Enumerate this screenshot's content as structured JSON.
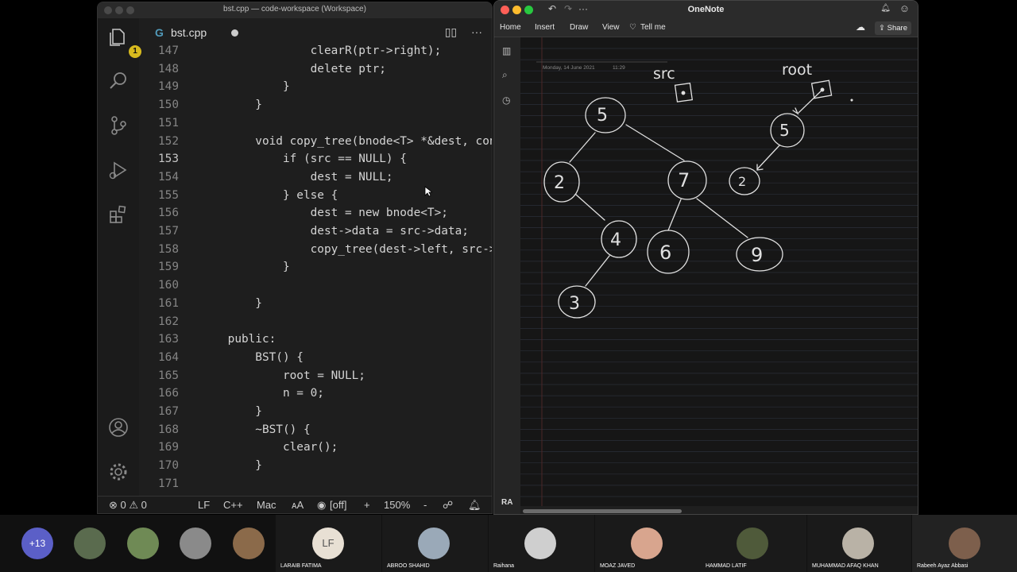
{
  "vscode": {
    "window_title": "bst.cpp — code-workspace (Workspace)",
    "explorer_badge": "1",
    "tab_label": "bst.cpp",
    "tab_icon": "G",
    "code_lines": [
      {
        "num": "147",
        "code": "                clearR(ptr->right);"
      },
      {
        "num": "148",
        "code": "                delete ptr;"
      },
      {
        "num": "149",
        "code": "            }"
      },
      {
        "num": "150",
        "code": "        }"
      },
      {
        "num": "151",
        "code": ""
      },
      {
        "num": "152",
        "code": "        void copy_tree(bnode<T> *&dest, const"
      },
      {
        "num": "153",
        "code": "            if (src == NULL) {"
      },
      {
        "num": "154",
        "code": "                dest = NULL;"
      },
      {
        "num": "155",
        "code": "            } else {"
      },
      {
        "num": "156",
        "code": "                dest = new bnode<T>;"
      },
      {
        "num": "157",
        "code": "                dest->data = src->data;"
      },
      {
        "num": "158",
        "code": "                copy_tree(dest->left, src->le"
      },
      {
        "num": "159",
        "code": "            }"
      },
      {
        "num": "160",
        "code": ""
      },
      {
        "num": "161",
        "code": "        }"
      },
      {
        "num": "162",
        "code": ""
      },
      {
        "num": "163",
        "code": "    public:"
      },
      {
        "num": "164",
        "code": "        BST() {"
      },
      {
        "num": "165",
        "code": "            root = NULL;"
      },
      {
        "num": "166",
        "code": "            n = 0;"
      },
      {
        "num": "167",
        "code": "        }"
      },
      {
        "num": "168",
        "code": "        ~BST() {"
      },
      {
        "num": "169",
        "code": "            clear();"
      },
      {
        "num": "170",
        "code": "        }"
      },
      {
        "num": "171",
        "code": ""
      }
    ],
    "active_line": "153",
    "status": {
      "problems": "⊗ 0 ⚠ 0",
      "eol": "LF",
      "lang": "C++",
      "platform": "Mac",
      "font": "ᴀA",
      "live": "[off]",
      "plus": "+",
      "zoom": "150%",
      "minus": "-"
    }
  },
  "onenote": {
    "title": "OneNote",
    "ribbon": [
      "Home",
      "Insert",
      "Draw",
      "View",
      "Tell me"
    ],
    "share": "Share",
    "date": "Monday, 14 June 2021",
    "time": "11:29",
    "user_initials": "RA",
    "ink": {
      "src_label": "src",
      "root_label": "root",
      "tree_nodes": [
        "5",
        "2",
        "7",
        "4",
        "6",
        "9",
        "3"
      ],
      "copy_nodes": [
        "5",
        "2"
      ]
    }
  },
  "participants": {
    "more": "+13",
    "named": [
      {
        "name": "LARAIB FATIMA",
        "initials": "LF"
      },
      {
        "name": "ABROO SHAHID",
        "initials": ""
      },
      {
        "name": "Raihana",
        "initials": ""
      },
      {
        "name": "MOAZ JAVED",
        "initials": ""
      },
      {
        "name": "HAMMAD LATIF",
        "initials": ""
      },
      {
        "name": "MUHAMMAD AFAQ KHAN",
        "initials": ""
      },
      {
        "name": "Rabeeh Ayaz Abbasi",
        "initials": ""
      }
    ]
  },
  "colors": {
    "vscode_bg": "#1e1e1e",
    "keyword": "#dcdcaa",
    "teams_accent": "#5b5fc7",
    "onenote_canvas": "#161616"
  }
}
